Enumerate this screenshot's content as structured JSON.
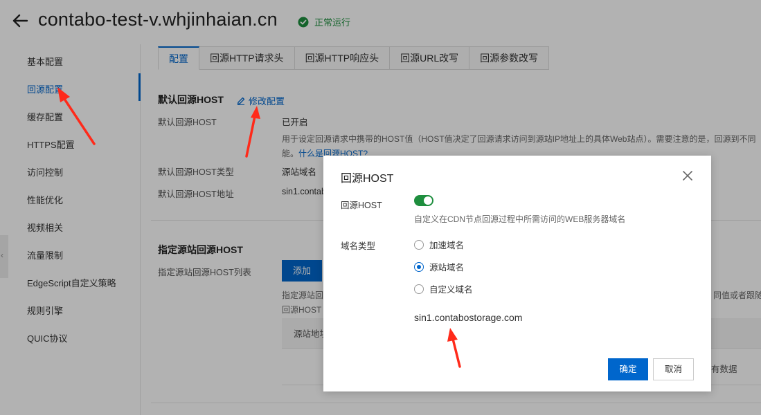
{
  "header": {
    "domain": "contabo-test-v.whjinhaian.cn",
    "status": "正常运行"
  },
  "sidebar": {
    "items": [
      {
        "label": "基本配置"
      },
      {
        "label": "回源配置"
      },
      {
        "label": "缓存配置"
      },
      {
        "label": "HTTPS配置"
      },
      {
        "label": "访问控制"
      },
      {
        "label": "性能优化"
      },
      {
        "label": "视频相关"
      },
      {
        "label": "流量限制"
      },
      {
        "label": "EdgeScript自定义策略"
      },
      {
        "label": "规则引擎"
      },
      {
        "label": "QUIC协议"
      }
    ]
  },
  "tabs": [
    {
      "label": "配置"
    },
    {
      "label": "回源HTTP请求头"
    },
    {
      "label": "回源HTTP响应头"
    },
    {
      "label": "回源URL改写"
    },
    {
      "label": "回源参数改写"
    }
  ],
  "default_host": {
    "title": "默认回源HOST",
    "edit_label": "修改配置",
    "rows": [
      {
        "label": "默认回源HOST",
        "value": "已开启"
      },
      {
        "label": "默认回源HOST类型",
        "value": "源站域名"
      },
      {
        "label": "默认回源HOST地址",
        "value": "sin1.contab"
      }
    ],
    "desc_line1": "用于设定回源请求中携带的HOST值（HOST值决定了回源请求访问到源站IP地址上的具体Web站点）。需要注意的是，回源到不同",
    "desc_line2_prefix": "能。",
    "desc_link": "什么是回源HOST?"
  },
  "specific_host": {
    "title": "指定源站回源HOST",
    "list_label": "指定源站回源HOST列表",
    "add_label": "添加",
    "desc_left1": "指定源站回",
    "desc_left2": "回源HOST",
    "desc_right": "同值或者跟随",
    "col_header": "源站地址",
    "empty_text": "有数据"
  },
  "modal": {
    "title": "回源HOST",
    "toggle_label": "回源HOST",
    "toggle_on": true,
    "toggle_hint": "自定义在CDN节点回源过程中所需访问的WEB服务器域名",
    "type_label": "域名类型",
    "options": [
      {
        "label": "加速域名",
        "checked": false
      },
      {
        "label": "源站域名",
        "checked": true
      },
      {
        "label": "自定义域名",
        "checked": false
      }
    ],
    "host_value": "sin1.contabostorage.com",
    "ok_label": "确定",
    "cancel_label": "取消"
  },
  "colors": {
    "accent": "#0066cc",
    "success": "#1e8e3e",
    "annotation_arrow": "#ff2a1a"
  }
}
